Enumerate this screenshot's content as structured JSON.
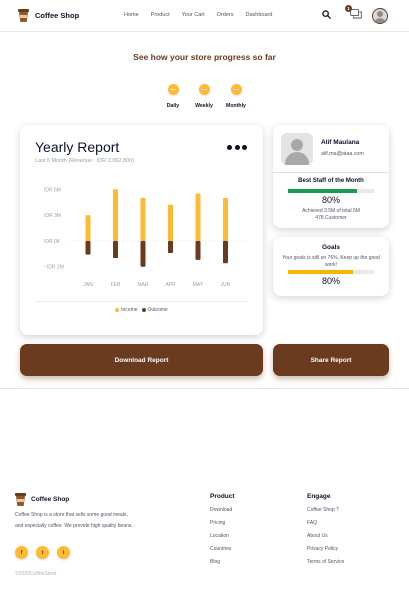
{
  "navbar": {
    "brand": "Coffee Shop",
    "links": [
      "Home",
      "Product",
      "Your Cart",
      "Orders",
      "Dashboard"
    ],
    "chat_badge": "1",
    "icons": [
      "search-icon",
      "chat-icon",
      "avatar"
    ]
  },
  "heading": "See how your store progress so far",
  "periods": [
    {
      "label": "Daily"
    },
    {
      "label": "Weekly"
    },
    {
      "label": "Monthly"
    }
  ],
  "report": {
    "title": "Yearly Report",
    "subtitle": "Last 6 Month (Revenue : IDR 2.062.800)",
    "legend_income": "Income",
    "legend_outcome": "Outcome"
  },
  "chart_data": {
    "type": "bar",
    "categories": [
      "JAN",
      "FEB",
      "MAR",
      "APR",
      "MAY",
      "JUN"
    ],
    "series": [
      {
        "name": "Income",
        "color": "#ffba33",
        "values": [
          3.0,
          6.0,
          5.0,
          4.2,
          5.5,
          5.0
        ]
      },
      {
        "name": "Outcome",
        "color": "#6a3b1f",
        "values": [
          -1.6,
          -2.0,
          -3.0,
          -1.4,
          -2.2,
          -2.6
        ]
      }
    ],
    "y_ticks": [
      "IDR 5M",
      "IDR 3M",
      "IDR 0K",
      "−IDR 2M"
    ],
    "y_tick_values": [
      6.0,
      3.0,
      0.0,
      -3.0
    ],
    "ylim": [
      -3.5,
      6.5
    ],
    "grid": false,
    "legend_position": "bottom"
  },
  "staff": {
    "name": "Alif Maulana",
    "email": "alif.ma@ataa.com",
    "title": "Best Staff of the Month",
    "progress": 0.8,
    "percent": "80%",
    "note_line1": "Achieved 3.5M of total 5M",
    "note_line2": "478 Customer",
    "bar_color": "#1a9a55"
  },
  "goals": {
    "title": "Goals",
    "text": "Your goals is still on 76%. Keep up the good work!",
    "progress": 0.76,
    "percent": "80%",
    "bar_color": "#f6b600"
  },
  "buttons": {
    "download": "Download Report",
    "share": "Share Report"
  },
  "footer": {
    "brand": "Coffee Shop",
    "description": "Coffee Shop is a store that sells some good meals, and especially coffee. We provide high quality beans.",
    "socials": [
      "facebook-icon",
      "twitter-icon",
      "instagram-icon"
    ],
    "social_glyphs": [
      "f",
      "t",
      "i"
    ],
    "copyright": "©2020CoffeeStore",
    "product_title": "Product",
    "product_links": [
      "Download",
      "Pricing",
      "Location",
      "Countries",
      "Blog"
    ],
    "engage_title": "Engage",
    "engage_links": [
      "Coffee Shop ?",
      "FAQ",
      "About Us",
      "Privacy Policy",
      "Terms of Service"
    ]
  },
  "colors": {
    "brand_brown": "#6a3b1f",
    "accent_yellow": "#ffba33"
  }
}
